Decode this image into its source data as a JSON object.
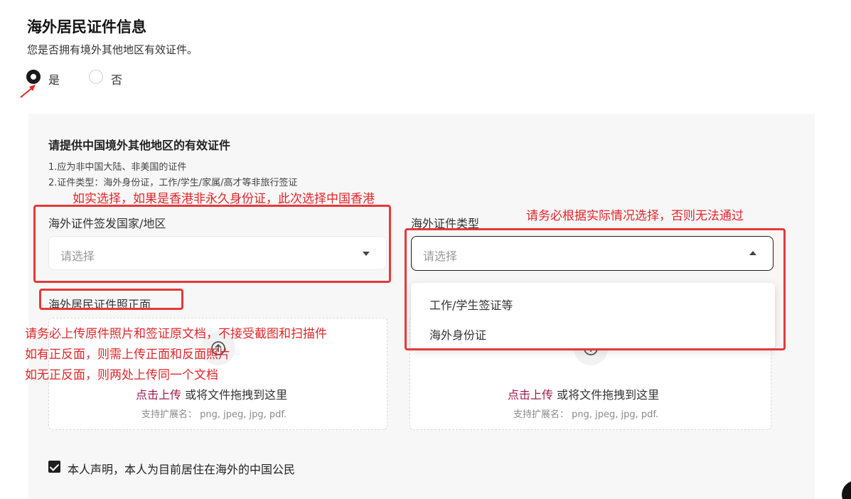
{
  "section": {
    "title": "海外居民证件信息",
    "question": "您是否拥有境外其他地区有效证件。",
    "options": [
      {
        "label": "是",
        "checked": true
      },
      {
        "label": "否",
        "checked": false
      }
    ]
  },
  "panel": {
    "title": "请提供中国境外其他地区的有效证件",
    "notes": [
      "1.应为非中国大陆、非美国的证件",
      "2.证件类型：海外身份证，工作/学生/家属/高才等非旅行签证"
    ],
    "country_field": {
      "label": "海外证件签发国家/地区",
      "placeholder": "请选择"
    },
    "type_field": {
      "label": "海外证件类型",
      "placeholder": "请选择",
      "options": [
        "工作/学生签证等",
        "海外身份证"
      ]
    },
    "front_upload": {
      "label": "海外居民证件照正面",
      "link": "点击上传",
      "text": "或将文件拖拽到这里",
      "hint": "支持扩展名：  png, jpeg, jpg, pdf."
    },
    "back_upload": {
      "link": "点击上传",
      "text": "或将文件拖拽到这里",
      "hint": "支持扩展名：  png, jpeg, jpg, pdf."
    },
    "declaration": {
      "label": "本人声明，本人为目前居住在海外的中国公民",
      "checked": true
    }
  },
  "annotations": {
    "country_note": "如实选择，如果是香港非永久身份证，此次选择中国香港",
    "type_note": "请务必根据实际情况选择，否则无法通过",
    "upload_notes": [
      "请务必上传原件照片和签证原文档，不接受截图和扫描件",
      "如有正反面，则需上传正面和反面照片",
      "如无正反面，则两处上传同一个文档"
    ]
  },
  "colors": {
    "annotation_red": "#e0262a",
    "link_accent": "#9e1c4a",
    "panel_bg": "#f7f7f7"
  }
}
